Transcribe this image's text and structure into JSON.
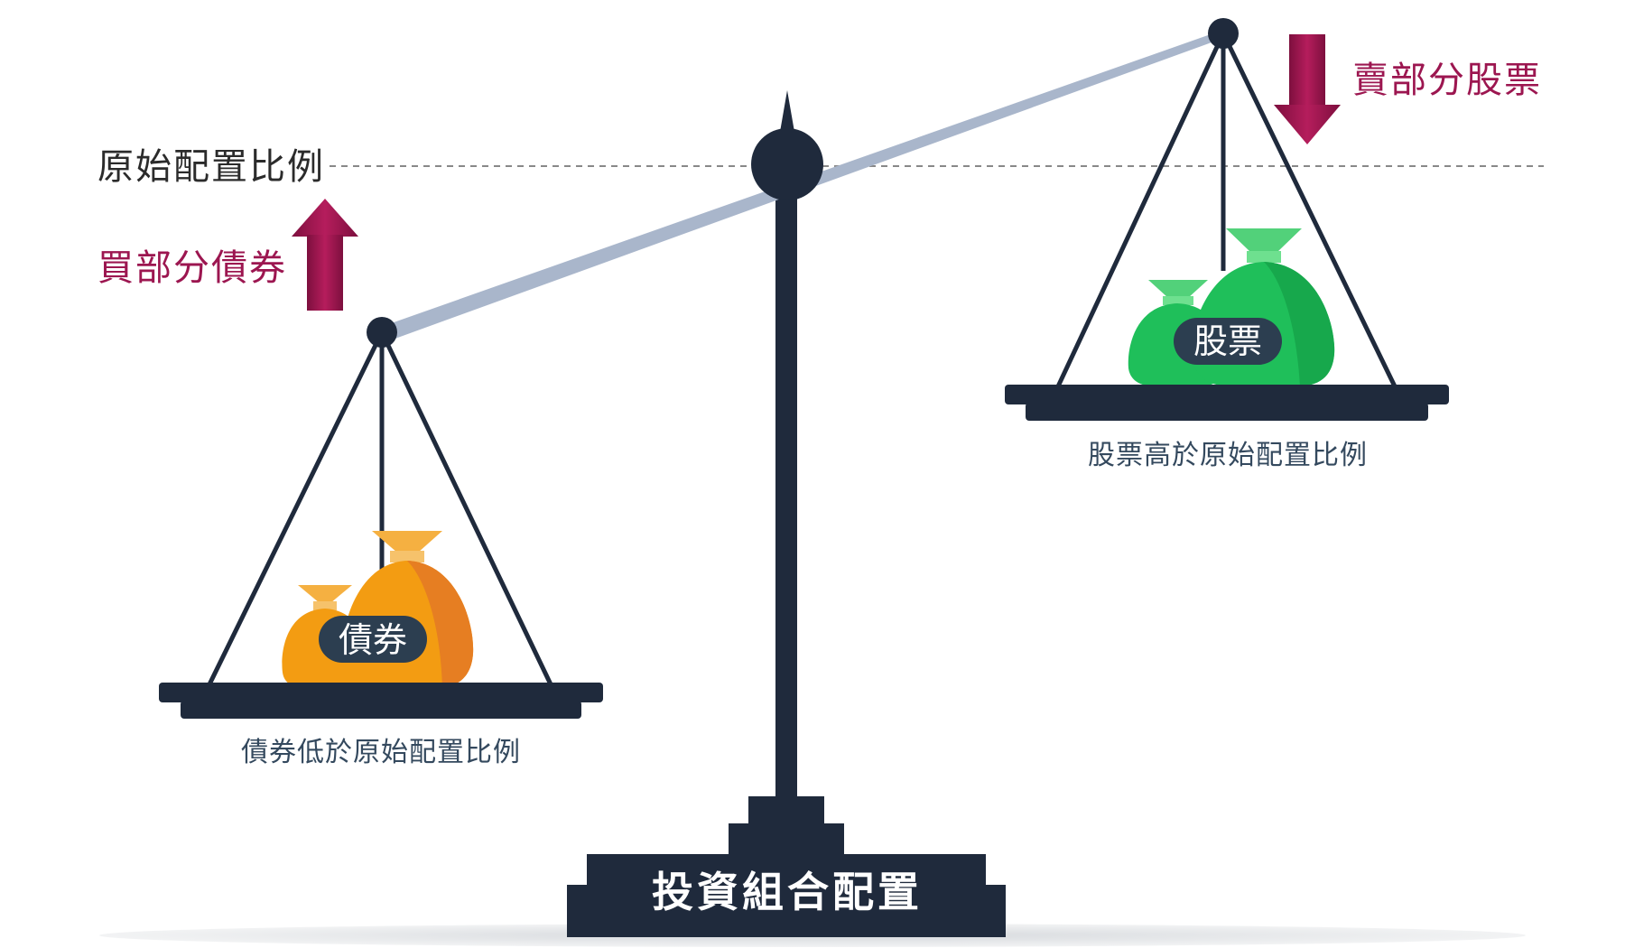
{
  "baseline_label": "原始配置比例",
  "left_pan": {
    "action_label": "買部分債券",
    "bag_label": "債券",
    "caption": "債券低於原始配置比例"
  },
  "right_pan": {
    "action_label": "賣部分股票",
    "bag_label": "股票",
    "caption": "股票高於原始配置比例"
  },
  "base_label": "投資組合配置",
  "colors": {
    "navy": "#1f2a3c",
    "beam": "#a9b6cb",
    "arrow": "#9c1650",
    "bonds": "#f39c12",
    "stocks": "#27ae60"
  }
}
